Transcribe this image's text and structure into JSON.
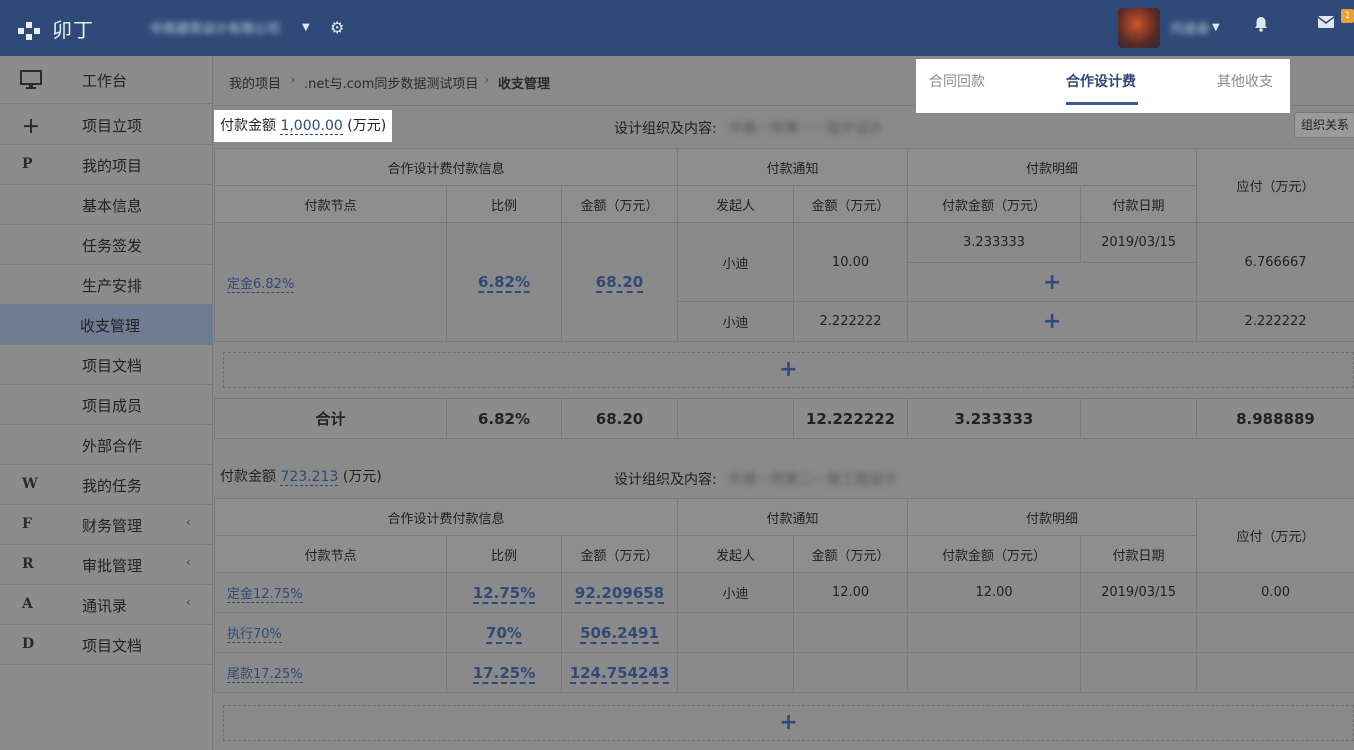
{
  "header": {
    "logo_text": "卯丁",
    "company_name": "中南建筑设计有限公司",
    "user_name": "刘迪迪",
    "mail_badge": "1"
  },
  "sidebar": {
    "workbench": "工作台",
    "items": [
      {
        "icon": "＋",
        "label": "项目立项"
      },
      {
        "icon": "P",
        "label": "我的项目"
      },
      {
        "icon": "",
        "label": "基本信息"
      },
      {
        "icon": "",
        "label": "任务签发"
      },
      {
        "icon": "",
        "label": "生产安排"
      },
      {
        "icon": "",
        "label": "收支管理"
      },
      {
        "icon": "",
        "label": "项目文档"
      },
      {
        "icon": "",
        "label": "项目成员"
      },
      {
        "icon": "",
        "label": "外部合作"
      },
      {
        "icon": "W",
        "label": "我的任务"
      },
      {
        "icon": "F",
        "label": "财务管理"
      },
      {
        "icon": "R",
        "label": "审批管理"
      },
      {
        "icon": "A",
        "label": "通讯录"
      },
      {
        "icon": "D",
        "label": "项目文档"
      }
    ]
  },
  "breadcrumb": {
    "item1": "我的项目",
    "item2": ".net与.com同步数据测试项目",
    "item3": "收支管理"
  },
  "tabs": [
    "合同回款",
    "合作设计费",
    "其他收支"
  ],
  "section1": {
    "amount_label": "付款金额",
    "amount_value": "1,000.00",
    "amount_unit": "(万元)",
    "org_label": "设计组织及内容:",
    "org_value": "中南一所第一一层外设计",
    "org_button": "组织关系"
  },
  "section2": {
    "amount_label": "付款金额",
    "amount_value": "723.213",
    "amount_unit": "(万元)",
    "org_label": "设计组织及内容:",
    "org_value": "中南一所第二一施工图设计"
  },
  "table_headers": {
    "group1": "合作设计费付款信息",
    "group2": "付款通知",
    "group3": "付款明细",
    "payable": "应付（万元）",
    "node": "付款节点",
    "ratio": "比例",
    "amount": "金额（万元）",
    "initiator": "发起人",
    "notice_amount": "金额（万元）",
    "pay_amount": "付款金额（万元）",
    "pay_date": "付款日期"
  },
  "table1": {
    "node": "定金6.82%",
    "ratio": "6.82%",
    "amount": "68.20",
    "rows": [
      {
        "initiator": "小迪",
        "notice_amount": "10.00",
        "pay_amount": "3.233333",
        "pay_date": "2019/03/15",
        "payable": "6.766667"
      },
      {
        "initiator": "小迪",
        "notice_amount": "2.222222",
        "payable": "2.222222"
      }
    ],
    "total": {
      "label": "合计",
      "ratio": "6.82%",
      "amount": "68.20",
      "notice_amount": "12.222222",
      "pay_amount": "3.233333",
      "payable": "8.988889"
    }
  },
  "table2": {
    "rows": [
      {
        "node": "定金12.75%",
        "ratio": "12.75%",
        "amount": "92.209658",
        "initiator": "小迪",
        "notice_amount": "12.00",
        "pay_amount": "12.00",
        "pay_date": "2019/03/15",
        "payable": "0.00"
      },
      {
        "node": "执行70%",
        "ratio": "70%",
        "amount": "506.2491"
      },
      {
        "node": "尾款17.25%",
        "ratio": "17.25%",
        "amount": "124.754243"
      }
    ]
  },
  "plus_symbol": "+"
}
